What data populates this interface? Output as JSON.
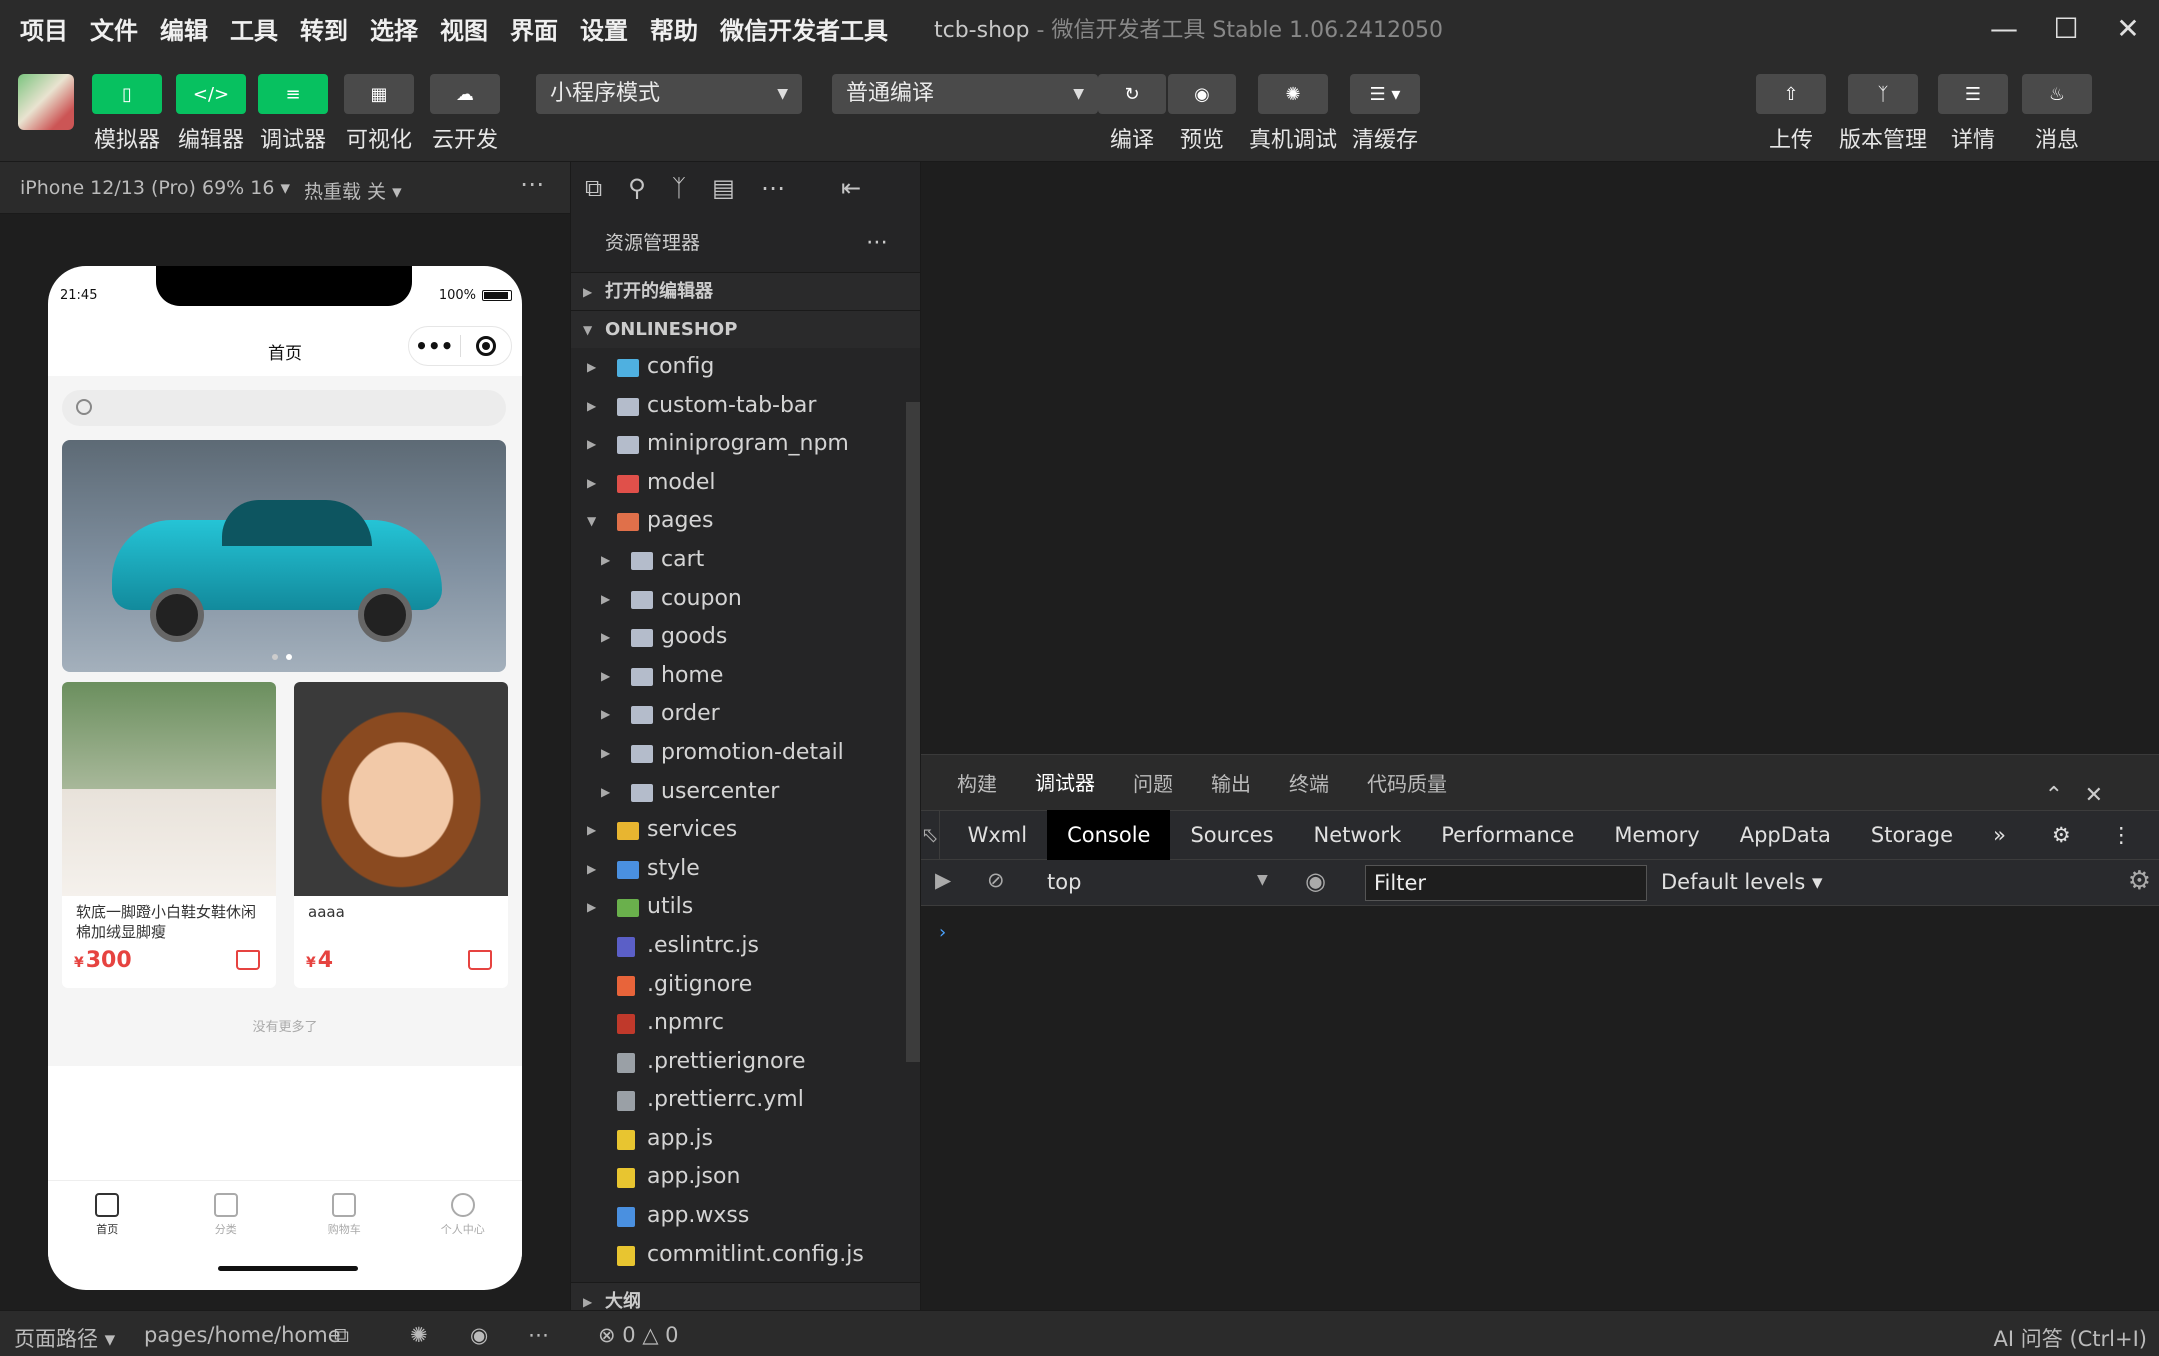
{
  "menu": [
    "项目",
    "文件",
    "编辑",
    "工具",
    "转到",
    "选择",
    "视图",
    "界面",
    "设置",
    "帮助",
    "微信开发者工具"
  ],
  "window": {
    "project": "tcb-shop",
    "app": "微信开发者工具 Stable 1.06.2412050"
  },
  "toolbar": {
    "left": [
      {
        "label": "模拟器",
        "icon": "phone-icon",
        "active": true
      },
      {
        "label": "编辑器",
        "icon": "code-icon",
        "active": true
      },
      {
        "label": "调试器",
        "icon": "debug-icon",
        "active": true
      },
      {
        "label": "可视化",
        "icon": "layout-icon",
        "active": false
      },
      {
        "label": "云开发",
        "icon": "cloud-icon",
        "active": false
      }
    ],
    "mode_select": "小程序模式",
    "compile_select": "普通编译",
    "center": [
      {
        "label": "编译",
        "icon": "refresh-icon"
      },
      {
        "label": "预览",
        "icon": "eye-icon"
      },
      {
        "label": "真机调试",
        "icon": "bug-icon"
      },
      {
        "label": "清缓存",
        "icon": "layers-icon"
      }
    ],
    "right": [
      {
        "label": "上传",
        "icon": "upload-icon"
      },
      {
        "label": "版本管理",
        "icon": "branch-icon"
      },
      {
        "label": "详情",
        "icon": "menu-icon"
      },
      {
        "label": "消息",
        "icon": "bell-icon"
      }
    ]
  },
  "simulator": {
    "device": "iPhone 12/13 (Pro) 69% 16 ▾",
    "hot_reload": "热重载 关 ▾",
    "time": "21:45",
    "battery": "100%",
    "page_title": "首页",
    "products": [
      {
        "name": "软底一脚蹬小白鞋女鞋休闲棉加绒显脚瘦",
        "currency": "¥",
        "price": "300"
      },
      {
        "name": "aaaa",
        "currency": "¥",
        "price": "4"
      }
    ],
    "no_more": "没有更多了",
    "tabs": [
      "首页",
      "分类",
      "购物车",
      "个人中心"
    ]
  },
  "explorer": {
    "title": "资源管理器",
    "open_editors": "打开的编辑器",
    "project": "ONLINESHOP",
    "outline": "大纲",
    "tree": [
      {
        "name": "config",
        "depth": 0,
        "type": "folder",
        "color": "#4fb0e0",
        "expanded": false
      },
      {
        "name": "custom-tab-bar",
        "depth": 0,
        "type": "folder",
        "color": "#b4bccb",
        "expanded": false
      },
      {
        "name": "miniprogram_npm",
        "depth": 0,
        "type": "folder",
        "color": "#b4bccb",
        "expanded": false
      },
      {
        "name": "model",
        "depth": 0,
        "type": "folder",
        "color": "#e0504a",
        "expanded": false
      },
      {
        "name": "pages",
        "depth": 0,
        "type": "folder",
        "color": "#e0704a",
        "expanded": true
      },
      {
        "name": "cart",
        "depth": 1,
        "type": "folder",
        "color": "#b4bccb",
        "expanded": false
      },
      {
        "name": "coupon",
        "depth": 1,
        "type": "folder",
        "color": "#b4bccb",
        "expanded": false
      },
      {
        "name": "goods",
        "depth": 1,
        "type": "folder",
        "color": "#b4bccb",
        "expanded": false
      },
      {
        "name": "home",
        "depth": 1,
        "type": "folder",
        "color": "#b4bccb",
        "expanded": false
      },
      {
        "name": "order",
        "depth": 1,
        "type": "folder",
        "color": "#b4bccb",
        "expanded": false
      },
      {
        "name": "promotion-detail",
        "depth": 1,
        "type": "folder",
        "color": "#b4bccb",
        "expanded": false
      },
      {
        "name": "usercenter",
        "depth": 1,
        "type": "folder",
        "color": "#b4bccb",
        "expanded": false
      },
      {
        "name": "services",
        "depth": 0,
        "type": "folder",
        "color": "#e8b530",
        "expanded": false
      },
      {
        "name": "style",
        "depth": 0,
        "type": "folder",
        "color": "#4a90e0",
        "expanded": false
      },
      {
        "name": "utils",
        "depth": 0,
        "type": "folder",
        "color": "#6ab04c",
        "expanded": false
      },
      {
        "name": ".eslintrc.js",
        "depth": 0,
        "type": "file",
        "color": "#5b5fc7"
      },
      {
        "name": ".gitignore",
        "depth": 0,
        "type": "file",
        "color": "#e8643a"
      },
      {
        "name": ".npmrc",
        "depth": 0,
        "type": "file",
        "color": "#c0392b"
      },
      {
        "name": ".prettierignore",
        "depth": 0,
        "type": "file",
        "color": "#9aa0a6"
      },
      {
        "name": ".prettierrc.yml",
        "depth": 0,
        "type": "file",
        "color": "#9aa0a6"
      },
      {
        "name": "app.js",
        "depth": 0,
        "type": "file",
        "color": "#e8c530"
      },
      {
        "name": "app.json",
        "depth": 0,
        "type": "file",
        "color": "#e8c530"
      },
      {
        "name": "app.wxss",
        "depth": 0,
        "type": "file",
        "color": "#4a90e0"
      },
      {
        "name": "commitlint.config.js",
        "depth": 0,
        "type": "file",
        "color": "#e8c530"
      }
    ]
  },
  "devtools": {
    "panel_tabs": [
      "构建",
      "调试器",
      "问题",
      "输出",
      "终端",
      "代码质量"
    ],
    "active_panel": "调试器",
    "tabs": [
      "Wxml",
      "Console",
      "Sources",
      "Network",
      "Performance",
      "Memory",
      "AppData",
      "Storage"
    ],
    "active_tab": "Console",
    "more": "»",
    "context": "top",
    "filter_placeholder": "Filter",
    "levels": "Default levels ▾",
    "prompt": "›"
  },
  "statusbar": {
    "path_label": "页面路径 ▾",
    "path": "pages/home/home",
    "errors": "0",
    "warnings": "0",
    "ai": "AI 问答 (Ctrl+I)"
  }
}
